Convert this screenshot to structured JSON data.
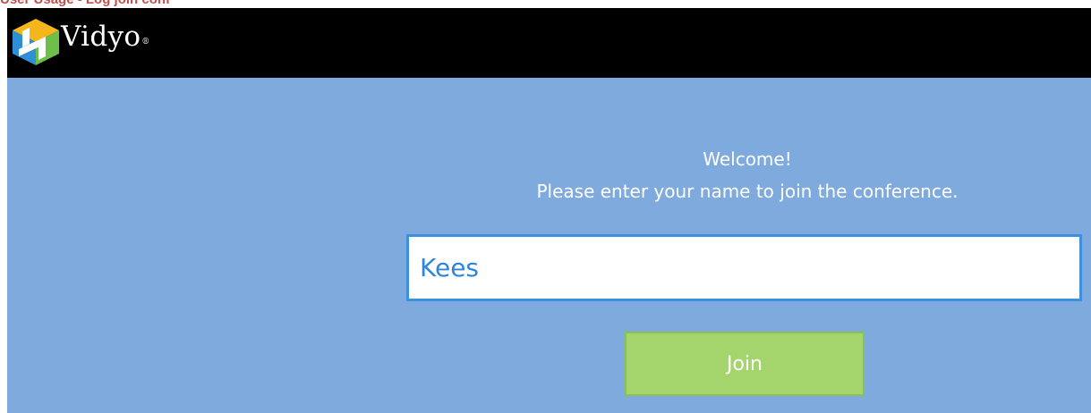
{
  "document": {
    "caption": "User Usage - Log join conf"
  },
  "header": {
    "logo_text": "Vidyo",
    "logo_trademark": "®",
    "logo_icon": "vidyo-cube-icon"
  },
  "welcome": {
    "title": "Welcome!",
    "subtitle": "Please enter your name to join the conference."
  },
  "name_input": {
    "value": "Kees"
  },
  "join_button": {
    "label": "Join"
  },
  "colors": {
    "header_bg": "#000000",
    "content_bg": "#7eaadd",
    "input_border": "#3d8fe0",
    "input_text": "#2f86d8",
    "button_bg": "#a4d56c",
    "caption_text": "#c0504d"
  }
}
